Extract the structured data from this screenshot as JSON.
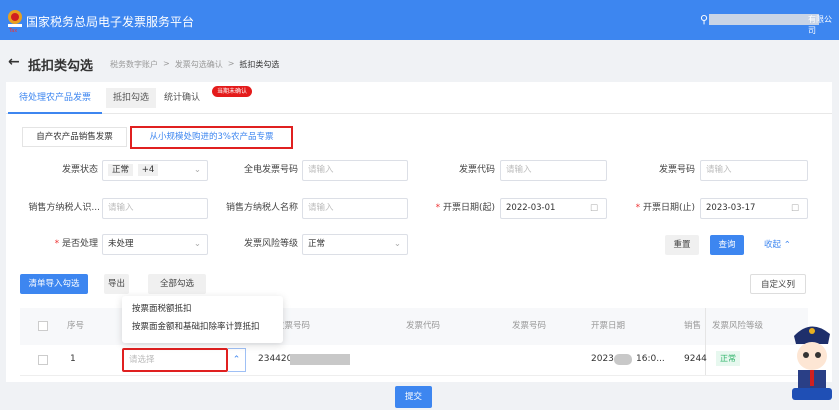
{
  "header": {
    "title": "国家税务总局电子发票服务平台",
    "company_suffix": "有限公司",
    "logo_text": "Tax"
  },
  "page": {
    "back": "←",
    "title": "抵扣类勾选",
    "breadcrumb": [
      "税务数字账户",
      "发票勾选确认",
      "抵扣类勾选"
    ],
    "sep": ">"
  },
  "tabs": [
    {
      "label": "待处理农产品发票"
    },
    {
      "label": "抵扣勾选"
    },
    {
      "label": "统计确认",
      "badge": "当期未确认"
    }
  ],
  "subtabs": [
    "自产农产品销售发票",
    "从小规模处购进的3%农产品专票"
  ],
  "form": {
    "invoice_status": {
      "label": "发票状态",
      "tag": "正常",
      "more": "+4"
    },
    "full_elec_no": {
      "label": "全电发票号码",
      "placeholder": "请输入"
    },
    "invoice_code": {
      "label": "发票代码",
      "placeholder": "请输入"
    },
    "invoice_no": {
      "label": "发票号码",
      "placeholder": "请输入"
    },
    "seller_id": {
      "label": "销售方纳税人识...",
      "placeholder": "请输入"
    },
    "seller_name": {
      "label": "销售方纳税人名称",
      "placeholder": "请输入"
    },
    "date_start": {
      "label": "开票日期(起)",
      "value": "2022-03-01"
    },
    "date_end": {
      "label": "开票日期(止)",
      "value": "2023-03-17"
    },
    "processed": {
      "label": "是否处理",
      "value": "未处理"
    },
    "risk": {
      "label": "发票风险等级",
      "value": "正常"
    },
    "reset": "重置",
    "query": "查询",
    "collapse": "收起"
  },
  "toolbar": {
    "import": "清单导入勾选",
    "export": "导出",
    "select_all": "全部勾选",
    "custom_cols": "自定义列"
  },
  "dropdown": [
    "按票面税额抵扣",
    "按票面金额和基础扣除率计算抵扣"
  ],
  "table": {
    "headers": [
      "序号",
      "发票号码",
      "发票代码",
      "发票号码",
      "开票日期",
      "销售",
      "发票风险等级"
    ],
    "rows": [
      {
        "index": "1",
        "placeholder": "请选择",
        "invoice_no": "234420C",
        "date_prefix": "2023-(",
        "date_suffix": "16:0...",
        "seller": "9244",
        "risk": "正常"
      }
    ]
  },
  "submit": "提交",
  "colors": {
    "primary": "#3d86f0",
    "highlight": "#e02020"
  }
}
